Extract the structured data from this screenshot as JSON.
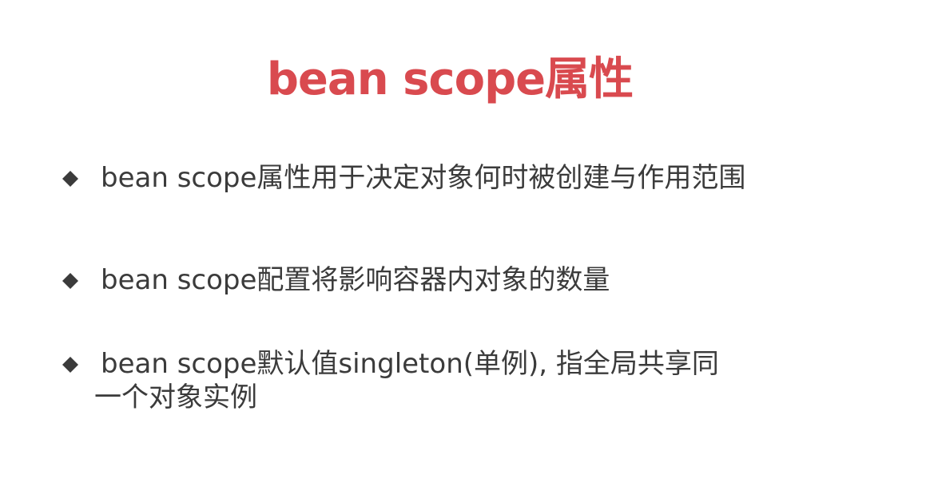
{
  "slide": {
    "title": "bean scope属性",
    "title_color": "#d94a4f",
    "text_color": "#3b3b3b",
    "bullets": [
      {
        "text": "bean scope属性用于决定对象何时被创建与作用范围"
      },
      {
        "text": "bean scope配置将影响容器内对象的数量"
      },
      {
        "text": "bean scope默认值singleton(单例), 指全局共享同",
        "continuation": "一个对象实例"
      }
    ],
    "bullet_icon": "diamond-bullet-icon"
  }
}
